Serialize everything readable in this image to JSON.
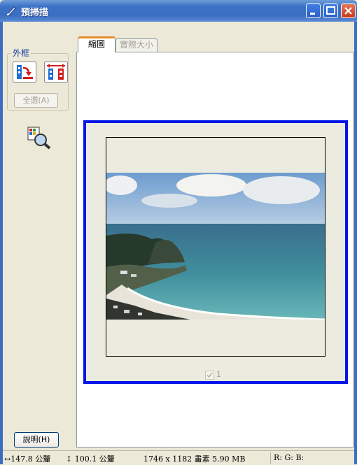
{
  "window": {
    "title": "預掃描"
  },
  "frame_group": {
    "label": "外框",
    "select_all_label": "全選(A)"
  },
  "tabs": [
    {
      "label": "縮圖"
    },
    {
      "label": "實際大小"
    }
  ],
  "thumbnail": {
    "index_label": "1",
    "checked": true
  },
  "help_button": {
    "label": "說明(H)"
  },
  "status": {
    "width": "↔147.8 公釐",
    "height": "↕ 100.1 公釐",
    "image_info": "1746 x 1182 畫素 5.90 MB",
    "rgb": "R: G: B:"
  },
  "colors": {
    "title_bar": "#3a6ec2",
    "thumbnail_border": "#0015e8",
    "tab_accent": "#e68b2c"
  }
}
